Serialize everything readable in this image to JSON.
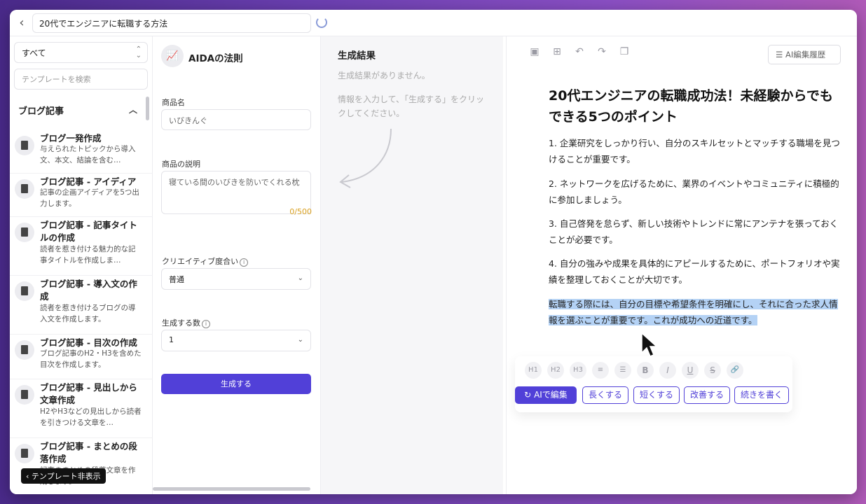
{
  "topbar": {
    "back_icon": "chevron-left-icon",
    "document_title": "20代でエンジニアに転職する方法"
  },
  "sidebar": {
    "filter_value": "すべて",
    "search_placeholder": "テンプレートを検索",
    "category": "ブログ記事",
    "items": [
      {
        "name": "ブログ一発作成",
        "desc": "与えられたトピックから導入文、本文、結論を含む…"
      },
      {
        "name": "ブログ記事 - アイディア",
        "desc": "記事の企画アイディアを5つ出力します。"
      },
      {
        "name": "ブログ記事 - 記事タイトルの作成",
        "desc": "読者を惹き付ける魅力的な記事タイトルを作成しま…"
      },
      {
        "name": "ブログ記事 - 導入文の作成",
        "desc": "読者を惹き付けるブログの導入文を作成します。"
      },
      {
        "name": "ブログ記事 - 目次の作成",
        "desc": "ブログ記事のH2・H3を含めた目次を作成します。"
      },
      {
        "name": "ブログ記事 - 見出しから文章作成",
        "desc": "H2やH3などの見出しから読者を引きつける文章を…"
      },
      {
        "name": "ブログ記事 - まとめの段落作成",
        "desc": "記事のまとめの段落文章を作成します。"
      }
    ],
    "hide_button": "テンプレート非表示"
  },
  "form": {
    "template_title": "AIDAの法則",
    "product_name_label": "商品名",
    "product_name_value": "いびきんぐ",
    "description_label": "商品の説明",
    "description_value": "寝ている間のいびきを防いでくれる枕",
    "char_count": "0/500",
    "creativity_label": "クリエイティブ度合い",
    "creativity_value": "普通",
    "count_label": "生成する数",
    "count_value": "1",
    "generate_button": "生成する"
  },
  "results": {
    "title": "生成結果",
    "empty_text": "生成結果がありません。",
    "hint_text": "情報を入力して、「生成する」をクリックしてください。"
  },
  "editor": {
    "history_button": "AI編集履歴",
    "doc_title": "20代エンジニアの転職成功法！未経験からでもできる5つのポイント",
    "paragraphs": [
      "1. 企業研究をしっかり行い、自分のスキルセットとマッチする職場を見つけることが重要です。",
      "2. ネットワークを広げるために、業界のイベントやコミュニティに積極的に参加しましょう。",
      "3. 自己啓発を怠らず、新しい技術やトレンドに常にアンテナを張っておくことが必要です。",
      "4. 自分の強みや成果を具体的にアピールするために、ポートフォリオや実績を整理しておくことが大切です。"
    ],
    "selected_paragraph": "転職する際には、自分の目標や希望条件を明確にし、それに合った求人情報を選ぶことが重要です。これが成功への近道です。",
    "format_tools": [
      "H1",
      "H2",
      "H3",
      "ordered-list-icon",
      "bullet-list-icon",
      "B",
      "I",
      "U",
      "strikethrough-icon",
      "link-icon"
    ],
    "actions": {
      "ai_edit": "AIで編集",
      "longer": "長くする",
      "shorter": "短くする",
      "improve": "改善する",
      "continue": "続きを書く"
    }
  },
  "colors": {
    "accent": "#5140d8",
    "highlight": "#b4d2f5",
    "counter": "#d9a020"
  }
}
